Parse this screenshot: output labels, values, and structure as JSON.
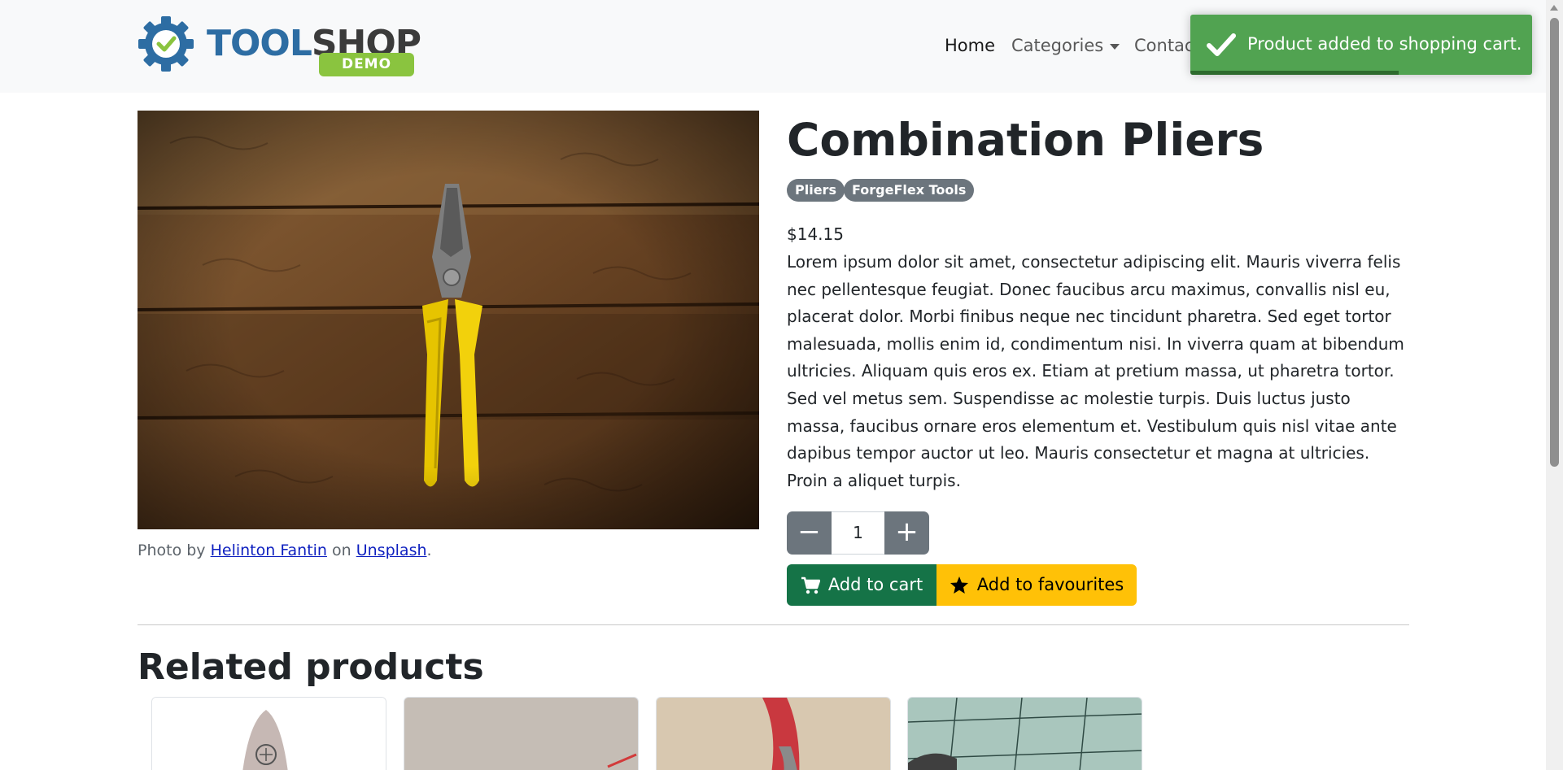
{
  "navbar": {
    "logo_text_tool": "TOOL",
    "logo_text_shop": "SHOP",
    "logo_badge": "DEMO",
    "links": {
      "home": "Home",
      "categories": "Categories",
      "contact": "Contac"
    }
  },
  "toast": {
    "message": "Product added to shopping cart.",
    "icon": "checkmark-icon",
    "progress": 0.61,
    "color": "#51a351"
  },
  "product": {
    "title": "Combination Pliers",
    "tags": [
      "Pliers",
      "ForgeFlex Tools"
    ],
    "price": "$14.15",
    "description": "Lorem ipsum dolor sit amet, consectetur adipiscing elit. Mauris viverra felis nec pellentesque feugiat. Donec faucibus arcu maximus, convallis nisl eu, placerat dolor. Morbi finibus neque nec tincidunt pharetra. Sed eget tortor malesuada, mollis enim id, condimentum nisi. In viverra quam at bibendum ultricies. Aliquam quis eros ex. Etiam at pretium massa, ut pharetra tortor. Sed vel metus sem. Suspendisse ac molestie turpis. Duis luctus justo massa, faucibus ornare eros elementum et. Vestibulum quis nisl vitae ante dapibus tempor auctor ut leo. Mauris consectetur et magna at ultricies. Proin a aliquet turpis.",
    "quantity": "1",
    "decrease_symbol": "−",
    "increase_symbol": "+",
    "add_to_cart_label": "Add to cart",
    "add_to_favourites_label": "Add to favourites",
    "image_credit": {
      "prefix": "Photo by",
      "author": "Helinton Fantin",
      "middle": "on",
      "source": "Unsplash",
      "suffix": "."
    }
  },
  "related": {
    "title": "Related products",
    "card_count": 4
  },
  "colors": {
    "cart_button": "#157347",
    "favourites_button": "#ffc107",
    "badge": "#6c757d",
    "logo_blue": "#2d6da3",
    "logo_green": "#8ac43f"
  }
}
